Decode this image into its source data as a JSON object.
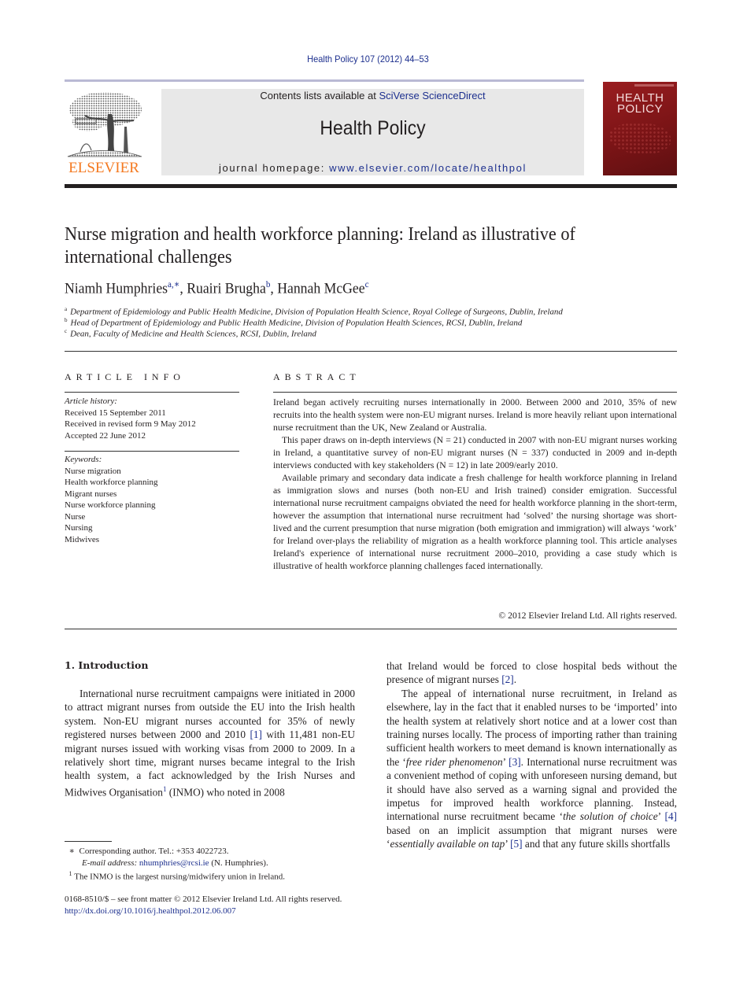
{
  "header": {
    "citation": "Health Policy 107 (2012) 44–53",
    "contents_prefix": "Contents lists available at ",
    "contents_link": "SciVerse ScienceDirect",
    "journal_name": "Health Policy",
    "homepage_prefix": "journal homepage: ",
    "homepage_link": "www.elsevier.com/locate/healthpol",
    "publisher_logo_text": "ELSEVIER",
    "cover_title_line1": "HEALTH",
    "cover_title_line2": "POLICY"
  },
  "article": {
    "title": "Nurse migration and health workforce planning: Ireland as illustrative of international challenges",
    "authors": [
      {
        "name": "Niamh Humphries",
        "sup": "a,∗",
        "sep": ", "
      },
      {
        "name": "Ruairi Brugha",
        "sup": "b",
        "sep": ", "
      },
      {
        "name": "Hannah McGee",
        "sup": "c",
        "sep": ""
      }
    ],
    "affiliations": [
      {
        "key": "a",
        "text": "Department of Epidemiology and Public Health Medicine, Division of Population Health Science, Royal College of Surgeons, Dublin, Ireland"
      },
      {
        "key": "b",
        "text": "Head of Department of Epidemiology and Public Health Medicine, Division of Population Health Sciences, RCSI, Dublin, Ireland"
      },
      {
        "key": "c",
        "text": "Dean, Faculty of Medicine and Health Sciences, RCSI, Dublin, Ireland"
      }
    ]
  },
  "article_info": {
    "heading": "ARTICLE INFO",
    "history_label": "Article history:",
    "history": [
      "Received 15 September 2011",
      "Received in revised form 9 May 2012",
      "Accepted 22 June 2012"
    ],
    "keywords_label": "Keywords:",
    "keywords": [
      "Nurse migration",
      "Health workforce planning",
      "Migrant nurses",
      "Nurse workforce planning",
      "Nurse",
      "Nursing",
      "Midwives"
    ]
  },
  "abstract": {
    "heading": "ABSTRACT",
    "paragraphs": [
      "Ireland began actively recruiting nurses internationally in 2000. Between 2000 and 2010, 35% of new recruits into the health system were non-EU migrant nurses. Ireland is more heavily reliant upon international nurse recruitment than the UK, New Zealand or Australia.",
      "This paper draws on in-depth interviews (N = 21) conducted in 2007 with non-EU migrant nurses working in Ireland, a quantitative survey of non-EU migrant nurses (N = 337) conducted in 2009 and in-depth interviews conducted with key stakeholders (N = 12) in late 2009/early 2010.",
      "Available primary and secondary data indicate a fresh challenge for health workforce planning in Ireland as immigration slows and nurses (both non-EU and Irish trained) consider emigration. Successful international nurse recruitment campaigns obviated the need for health workforce planning in the short-term, however the assumption that international nurse recruitment had ‘solved’ the nursing shortage was short-lived and the current presumption that nurse migration (both emigration and immigration) will always ‘work’ for Ireland over-plays the reliability of migration as a health workforce planning tool. This article analyses Ireland's experience of international nurse recruitment 2000–2010, providing a case study which is illustrative of health workforce planning challenges faced internationally."
    ],
    "copyright": "© 2012 Elsevier Ireland Ltd. All rights reserved."
  },
  "body": {
    "intro_heading": "1.  Introduction",
    "left": {
      "p1_a": "International nurse recruitment campaigns were initiated in 2000 to attract migrant nurses from outside the EU into the Irish health system. Non-EU migrant nurses accounted for 35% of newly registered nurses between 2000 and 2010 ",
      "ref1": "[1]",
      "p1_b": " with 11,481 non-EU migrant nurses issued with working visas from 2000 to 2009. In a relatively short time, migrant nurses became integral to the Irish health system, a fact acknowledged by the Irish Nurses and Midwives Organisation",
      "fn1": "1",
      "p1_c": " (INMO) who noted in 2008"
    },
    "right": {
      "p1_a": "that Ireland would be forced to close hospital beds without the presence of migrant nurses ",
      "ref2": "[2]",
      "p1_b": ".",
      "p2_a": "The appeal of international nurse recruitment, in Ireland as elsewhere, lay in the fact that it enabled nurses to be ‘imported’ into the health system at relatively short notice and at a lower cost than training nurses locally. The process of importing rather than training sufficient health workers to meet demand is known internationally as the ‘",
      "p2_it1": "free rider phenomenon",
      "p2_b": "’ ",
      "ref3": "[3]",
      "p2_c": ". International nurse recruitment was a convenient method of coping with unforeseen nursing demand, but it should have also served as a warning signal and provided the impetus for improved health workforce planning. Instead, international nurse recruitment became ‘",
      "p2_it2": "the solution of choice",
      "p2_d": "’ ",
      "ref4": "[4]",
      "p2_e": " based on an implicit assumption that migrant nurses were ‘",
      "p2_it3": "essentially available on tap",
      "p2_f": "’ ",
      "ref5": "[5]",
      "p2_g": " and that any future skills shortfalls"
    }
  },
  "footnotes": {
    "corresponding_mark": "∗",
    "corresponding": "Corresponding author. Tel.: +353 4022723.",
    "email_label": "E-mail address:",
    "email": "nhumphries@rcsi.ie",
    "email_suffix": " (N. Humphries).",
    "fn1_mark": "1",
    "fn1": "The INMO is the largest nursing/midwifery union in Ireland."
  },
  "front_matter": {
    "issn": "0168-8510/$ – see front matter © 2012 Elsevier Ireland Ltd. All rights reserved.",
    "doi": "http://dx.doi.org/10.1016/j.healthpol.2012.06.007"
  },
  "colors": {
    "link": "#1c2f8e",
    "elsevier_orange": "#f47920",
    "cover_red": "#8b1a1c",
    "header_box": "#e8e8e8"
  }
}
